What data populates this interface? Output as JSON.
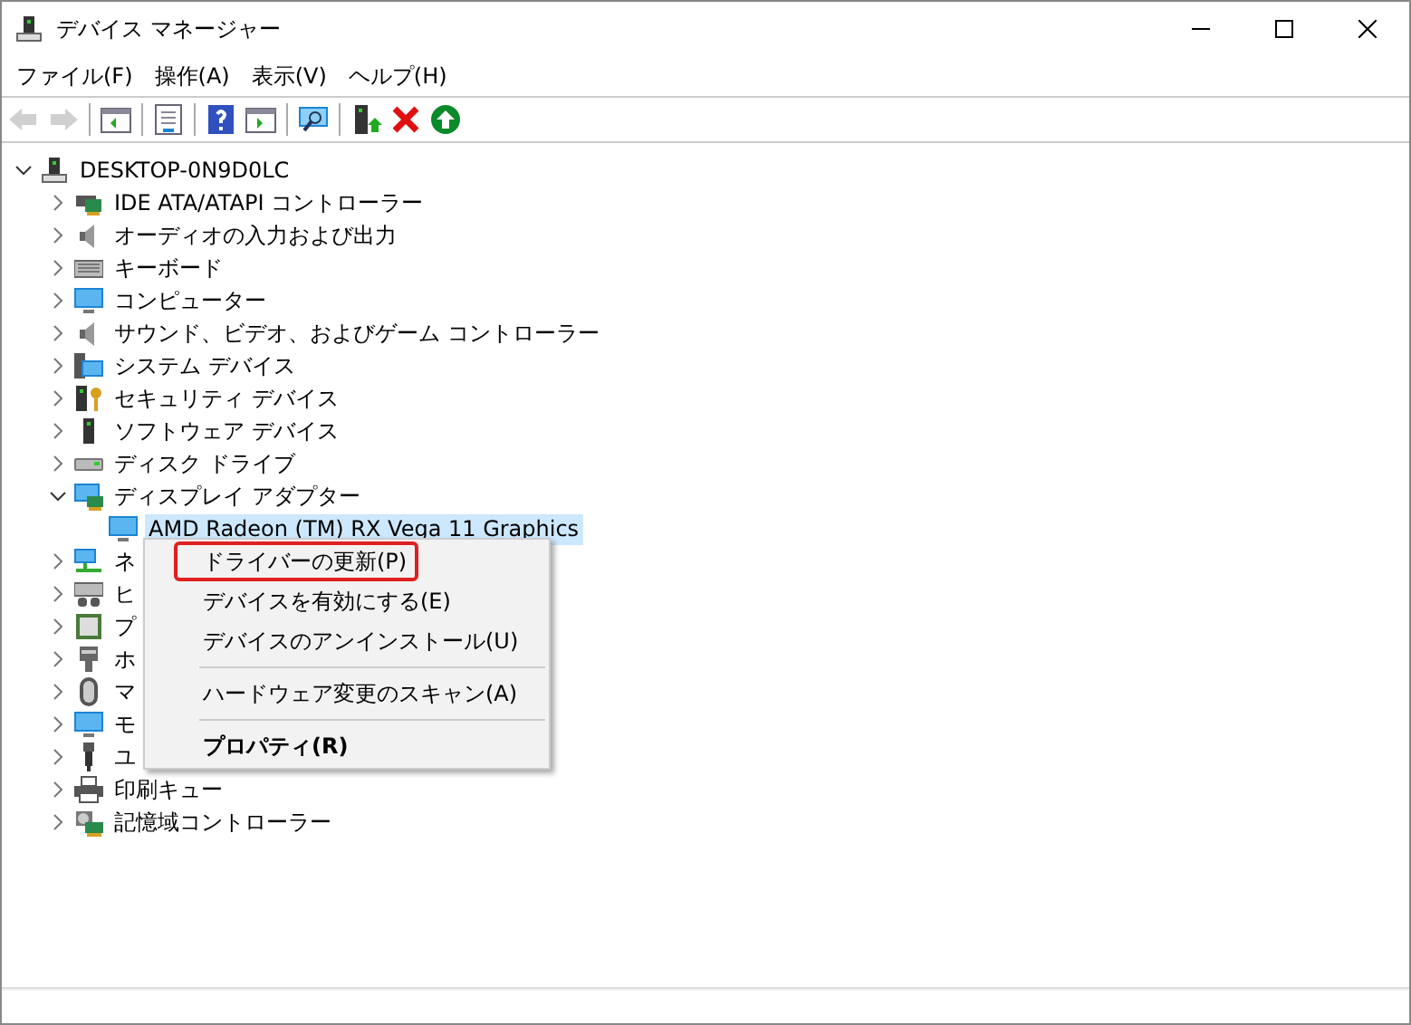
{
  "window": {
    "title": "デバイス マネージャー"
  },
  "menu_bar": [
    "ファイル(F)",
    "操作(A)",
    "表示(V)",
    "ヘルプ(H)"
  ],
  "toolbar": [
    {
      "kind": "back",
      "disabled": true
    },
    {
      "kind": "forward",
      "disabled": true
    },
    {
      "kind": "separator"
    },
    {
      "kind": "panel",
      "disabled": false
    },
    {
      "kind": "separator"
    },
    {
      "kind": "properties",
      "disabled": false
    },
    {
      "kind": "separator"
    },
    {
      "kind": "help",
      "disabled": false
    },
    {
      "kind": "panel2",
      "disabled": false
    },
    {
      "kind": "separator"
    },
    {
      "kind": "scan",
      "disabled": false
    },
    {
      "kind": "separator"
    },
    {
      "kind": "update",
      "disabled": false
    },
    {
      "kind": "remove",
      "disabled": false
    },
    {
      "kind": "enable",
      "disabled": false
    }
  ],
  "tree": {
    "label": "DESKTOP-0N9D0LC",
    "kind": "computer",
    "expanded": true,
    "selected": false,
    "children": [
      {
        "label": "IDE ATA/ATAPI コントローラー",
        "kind": "ide",
        "expanded": false,
        "selected": false
      },
      {
        "label": "オーディオの入力および出力",
        "kind": "audio",
        "expanded": false,
        "selected": false
      },
      {
        "label": "キーボード",
        "kind": "keyboard",
        "expanded": false,
        "selected": false
      },
      {
        "label": "コンピューター",
        "kind": "monitor",
        "expanded": false,
        "selected": false
      },
      {
        "label": "サウンド、ビデオ、およびゲーム コントローラー",
        "kind": "audio",
        "expanded": false,
        "selected": false
      },
      {
        "label": "システム デバイス",
        "kind": "system",
        "expanded": false,
        "selected": false
      },
      {
        "label": "セキュリティ デバイス",
        "kind": "security",
        "expanded": false,
        "selected": false
      },
      {
        "label": "ソフトウェア デバイス",
        "kind": "software",
        "expanded": false,
        "selected": false
      },
      {
        "label": "ディスク ドライブ",
        "kind": "disk",
        "expanded": false,
        "selected": false
      },
      {
        "label": "ディスプレイ アダプター",
        "kind": "display",
        "expanded": true,
        "selected": false,
        "children": [
          {
            "label": "AMD Radeon (TM) RX Vega 11 Graphics",
            "kind": "monitor",
            "selected": true
          }
        ]
      },
      {
        "label": "ネ",
        "kind": "network",
        "expanded": false,
        "selected": false
      },
      {
        "label": "ヒ",
        "kind": "hid",
        "expanded": false,
        "selected": false
      },
      {
        "label": "プ",
        "kind": "processor",
        "expanded": false,
        "selected": false
      },
      {
        "label": "ホ",
        "kind": "port",
        "expanded": false,
        "selected": false
      },
      {
        "label": "マ",
        "kind": "mouse",
        "expanded": false,
        "selected": false
      },
      {
        "label": "モ",
        "kind": "monitor",
        "expanded": false,
        "selected": false
      },
      {
        "label": "ユ",
        "kind": "usb",
        "expanded": false,
        "selected": false
      },
      {
        "label": "印刷キュー",
        "kind": "printer",
        "expanded": false,
        "selected": false
      },
      {
        "label": "記憶域コントローラー",
        "kind": "storage",
        "expanded": false,
        "selected": false
      }
    ]
  },
  "context_menu": [
    {
      "kind": "item",
      "label": "ドライバーの更新(P)",
      "selected": true,
      "default": false
    },
    {
      "kind": "item",
      "label": "デバイスを有効にする(E)",
      "selected": false,
      "default": false
    },
    {
      "kind": "item",
      "label": "デバイスのアンインストール(U)",
      "selected": false,
      "default": false
    },
    {
      "kind": "separator"
    },
    {
      "kind": "item",
      "label": "ハードウェア変更のスキャン(A)",
      "selected": false,
      "default": false
    },
    {
      "kind": "separator"
    },
    {
      "kind": "item",
      "label": "プロパティ(R)",
      "selected": false,
      "default": true
    }
  ]
}
